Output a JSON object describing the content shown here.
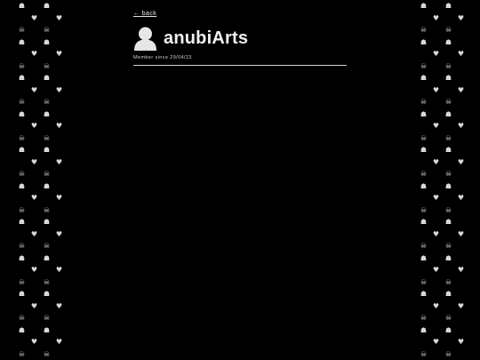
{
  "nav": {
    "back_label": "← back"
  },
  "profile": {
    "username": "anubiArts",
    "member_since": "Member since 29/04/23",
    "avatar_icon": "user-silhouette-icon"
  },
  "decor": {
    "pattern_icons": [
      "ghost-icon",
      "heart-icon",
      "skull-icon"
    ],
    "pattern_color": "#d8d8d8",
    "background_color": "#000000"
  }
}
